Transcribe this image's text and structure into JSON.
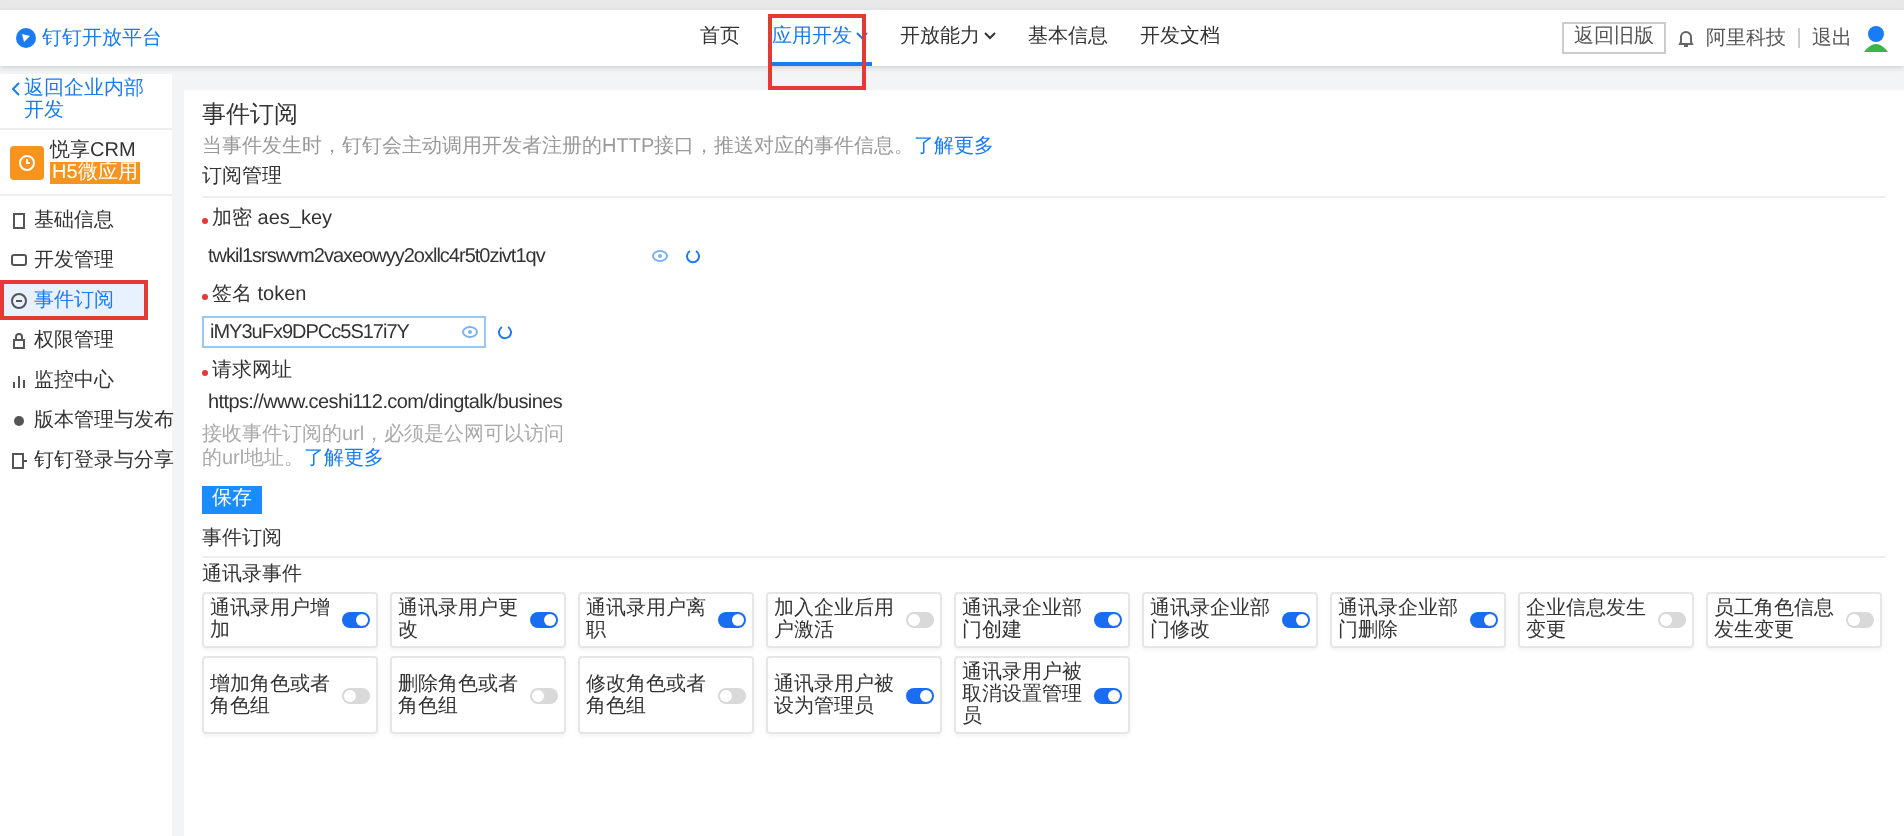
{
  "header": {
    "logo": "钉钉开放平台",
    "nav": [
      {
        "label": "首页",
        "selected": false,
        "dropdown": false
      },
      {
        "label": "应用开发",
        "selected": true,
        "dropdown": true
      },
      {
        "label": "开放能力",
        "selected": false,
        "dropdown": true
      },
      {
        "label": "基本信息",
        "selected": false,
        "dropdown": false
      },
      {
        "label": "开发文档",
        "selected": false,
        "dropdown": false
      }
    ],
    "old_version_button": "返回旧版",
    "org": "阿里科技",
    "logout": "退出"
  },
  "sidebar": {
    "back": "返回企业内部开发",
    "app_name": "悦享CRM",
    "app_tag": "H5微应用",
    "items": [
      {
        "label": "基础信息",
        "selected": false
      },
      {
        "label": "开发管理",
        "selected": false
      },
      {
        "label": "事件订阅",
        "selected": true
      },
      {
        "label": "权限管理",
        "selected": false
      },
      {
        "label": "监控中心",
        "selected": false
      },
      {
        "label": "版本管理与发布",
        "selected": false
      },
      {
        "label": "钉钉登录与分享",
        "selected": false
      }
    ]
  },
  "content": {
    "title": "事件订阅",
    "description": "当事件发生时，钉钉会主动调用开发者注册的HTTP接口，推送对应的事件信息。",
    "description_link": "了解更多",
    "management_heading": "订阅管理",
    "aes_key": {
      "label": "加密 aes_key",
      "value": "twkil1srswvm2vaxeowyy2oxllc4r5t0zivt1qv"
    },
    "token": {
      "label": "签名 token",
      "value": "iMY3uFx9DPCc5S17i7Y"
    },
    "url": {
      "label": "请求网址",
      "value": "https://www.ceshi112.com/dingtalk/busines"
    },
    "url_hint": "接收事件订阅的url，必须是公网可以访问的url地址。",
    "url_hint_link": "了解更多",
    "save_button": "保存",
    "events_heading": "事件订阅",
    "group": "通讯录事件",
    "events": [
      {
        "label": "通讯录用户增加",
        "on": true
      },
      {
        "label": "通讯录用户更改",
        "on": true
      },
      {
        "label": "通讯录用户离职",
        "on": true
      },
      {
        "label": "加入企业后用户激活",
        "on": false
      },
      {
        "label": "通讯录企业部门创建",
        "on": true
      },
      {
        "label": "通讯录企业部门修改",
        "on": true
      },
      {
        "label": "通讯录企业部门删除",
        "on": true
      },
      {
        "label": "企业信息发生变更",
        "on": false
      },
      {
        "label": "员工角色信息发生变更",
        "on": false
      },
      {
        "label": "增加角色或者角色组",
        "on": false
      },
      {
        "label": "删除角色或者角色组",
        "on": false
      },
      {
        "label": "修改角色或者角色组",
        "on": false
      },
      {
        "label": "通讯录用户被设为管理员",
        "on": true
      },
      {
        "label": "通讯录用户被取消设置管理员",
        "on": true
      }
    ]
  }
}
